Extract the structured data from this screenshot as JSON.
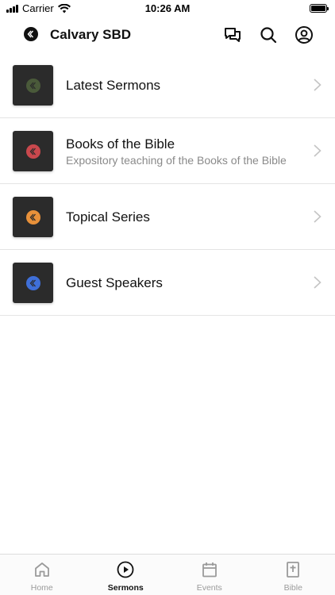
{
  "status_bar": {
    "carrier": "Carrier",
    "time": "10:26 AM",
    "icons": [
      "signal-icon",
      "wifi-icon",
      "battery-icon"
    ]
  },
  "header": {
    "title": "Calvary SBD",
    "icons": [
      "chat-icon",
      "search-icon",
      "profile-icon"
    ]
  },
  "sermon_categories": [
    {
      "title": "Latest Sermons",
      "subtitle": "",
      "accent": "#4a5a3a"
    },
    {
      "title": "Books of the Bible",
      "subtitle": "Expository teaching of the Books of the Bible",
      "accent": "#c9484d"
    },
    {
      "title": "Topical Series",
      "subtitle": "",
      "accent": "#e8913a"
    },
    {
      "title": "Guest Speakers",
      "subtitle": "",
      "accent": "#3f6fd8"
    }
  ],
  "tab_bar": {
    "active": "Sermons",
    "tabs": [
      {
        "label": "Home",
        "icon": "home-icon"
      },
      {
        "label": "Sermons",
        "icon": "play-circle-icon"
      },
      {
        "label": "Events",
        "icon": "calendar-icon"
      },
      {
        "label": "Bible",
        "icon": "bible-icon"
      }
    ]
  }
}
